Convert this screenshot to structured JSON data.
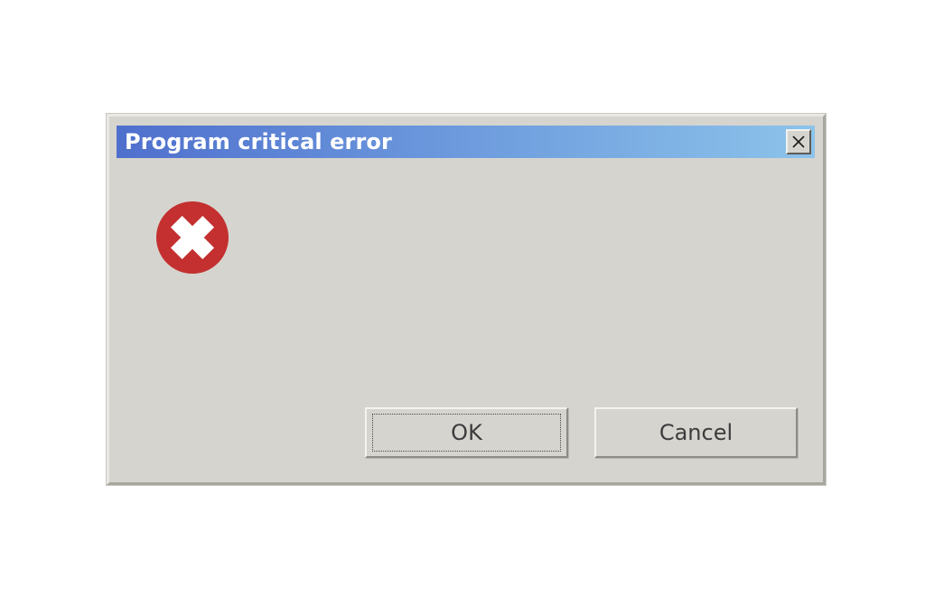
{
  "dialog": {
    "title": "Program critical error",
    "close_icon": "close-icon",
    "error_icon": "error-x-icon",
    "buttons": {
      "ok_label": "OK",
      "cancel_label": "Cancel"
    },
    "colors": {
      "titlebar_start": "#4f6fcd",
      "titlebar_end": "#8cc3ea",
      "error_icon": "#c3302f",
      "body": "#d6d4ce"
    }
  }
}
